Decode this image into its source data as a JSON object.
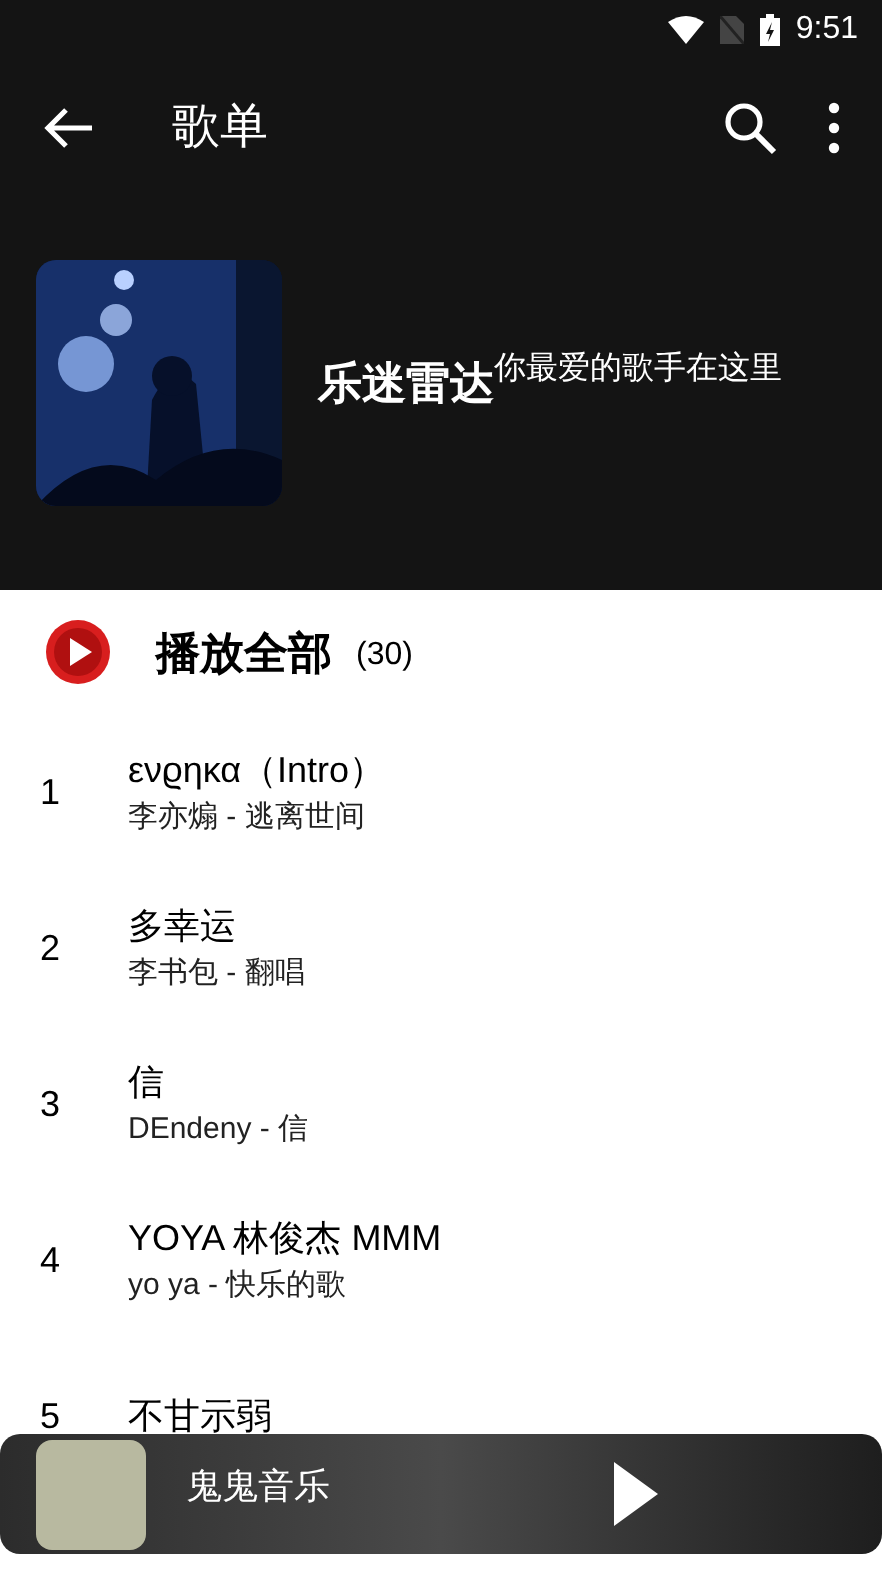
{
  "status_bar": {
    "time": "9:51"
  },
  "toolbar": {
    "title": "歌单"
  },
  "playlist": {
    "title": "乐迷雷达",
    "description": "你最爱的歌手在这里"
  },
  "play_all": {
    "label": "播放全部",
    "count": "(30)"
  },
  "songs": [
    {
      "index": "1",
      "title": "ενϱηκα（Intro）",
      "subtitle": "李亦煽 - 逃离世间"
    },
    {
      "index": "2",
      "title": "多幸运",
      "subtitle": "李书包 - 翻唱"
    },
    {
      "index": "3",
      "title": "信",
      "subtitle": "DEndeny - 信"
    },
    {
      "index": "4",
      "title": "YOYA 林俊杰 MMM",
      "subtitle": "yo ya - 快乐的歌"
    },
    {
      "index": "5",
      "title": "不甘示弱"
    }
  ],
  "player": {
    "title": "鬼鬼音乐"
  }
}
